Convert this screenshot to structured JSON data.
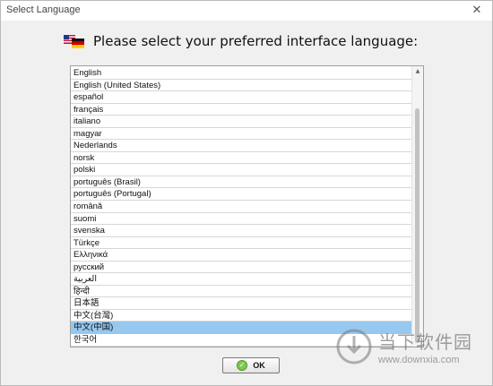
{
  "window": {
    "title": "Select Language",
    "close_glyph": "✕"
  },
  "header": {
    "text": "Please select your preferred interface language:",
    "icon": "flags-icon"
  },
  "languages": [
    "English",
    "English (United States)",
    "español",
    "français",
    "italiano",
    "magyar",
    "Nederlands",
    "norsk",
    "polski",
    "português (Brasil)",
    "português (Portugal)",
    "română",
    "suomi",
    "svenska",
    "Türkçe",
    "Ελληνικά",
    "русский",
    "العربية",
    "हिन्दी",
    "日本語",
    "中文(台灣)",
    "中文(中国)",
    "한국어"
  ],
  "selected_language": "中文(中国)",
  "ok_button": {
    "label": "OK",
    "icon": "check-icon"
  },
  "watermark": {
    "name": "当下软件园",
    "url": "www.downxia.com"
  },
  "colors": {
    "selection": "#96c8f0",
    "ok_icon": "#7cc94f"
  }
}
